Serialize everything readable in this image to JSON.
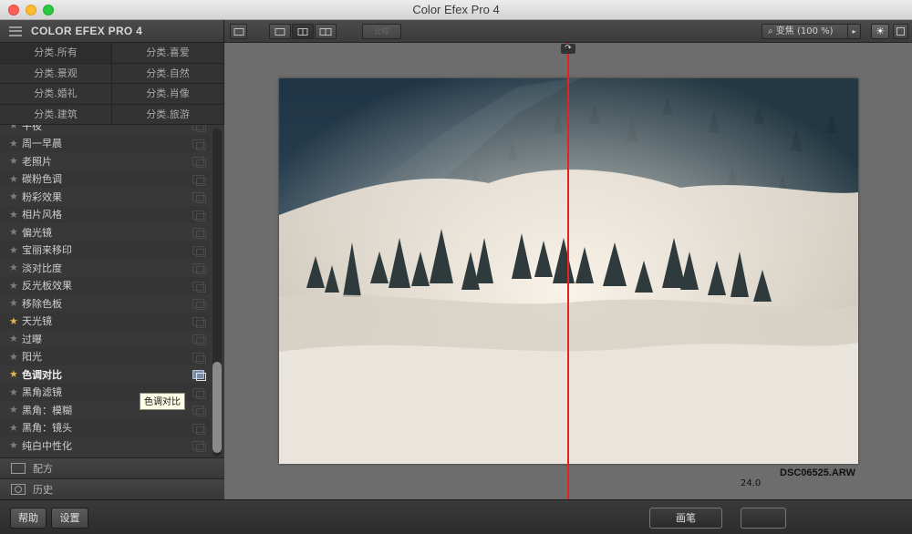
{
  "window": {
    "title": "Color Efex Pro 4"
  },
  "sidebar": {
    "brand": "COLOR EFEX PRO 4",
    "categories": [
      "分类.所有",
      "分类.喜爱",
      "分类.景观",
      "分类.自然",
      "分类.婚礼",
      "分类.肖像",
      "分类.建筑",
      "分类.旅游"
    ],
    "filters": [
      {
        "name": "午夜",
        "favorite": false
      },
      {
        "name": "周一早晨",
        "favorite": false
      },
      {
        "name": "老照片",
        "favorite": false
      },
      {
        "name": "碳粉色调",
        "favorite": false
      },
      {
        "name": "粉彩效果",
        "favorite": false
      },
      {
        "name": "相片风格",
        "favorite": false
      },
      {
        "name": "偏光镜",
        "favorite": false
      },
      {
        "name": "宝丽来移印",
        "favorite": false
      },
      {
        "name": "淡对比度",
        "favorite": false
      },
      {
        "name": "反光板效果",
        "favorite": false
      },
      {
        "name": "移除色板",
        "favorite": false
      },
      {
        "name": "天光镜",
        "favorite": true
      },
      {
        "name": "过曝",
        "favorite": false
      },
      {
        "name": "阳光",
        "favorite": false
      },
      {
        "name": "色调对比",
        "favorite": true,
        "selected": true
      },
      {
        "name": "黑角滤镜",
        "favorite": false
      },
      {
        "name": "黑角：模糊",
        "favorite": false
      },
      {
        "name": "黑角：镜头",
        "favorite": false
      },
      {
        "name": "纯白中性化",
        "favorite": false
      }
    ],
    "tooltip": "色调对比",
    "recipes_label": "配方",
    "history_label": "历史"
  },
  "toolbar": {
    "zoom_label": "变焦 (100 %)",
    "compare_label": "比较"
  },
  "canvas": {
    "filename": "DSC06525.ARW",
    "filesize": "24.0"
  },
  "bottombar": {
    "help_label": "帮助",
    "settings_label": "设置",
    "brush_label": "画笔"
  }
}
